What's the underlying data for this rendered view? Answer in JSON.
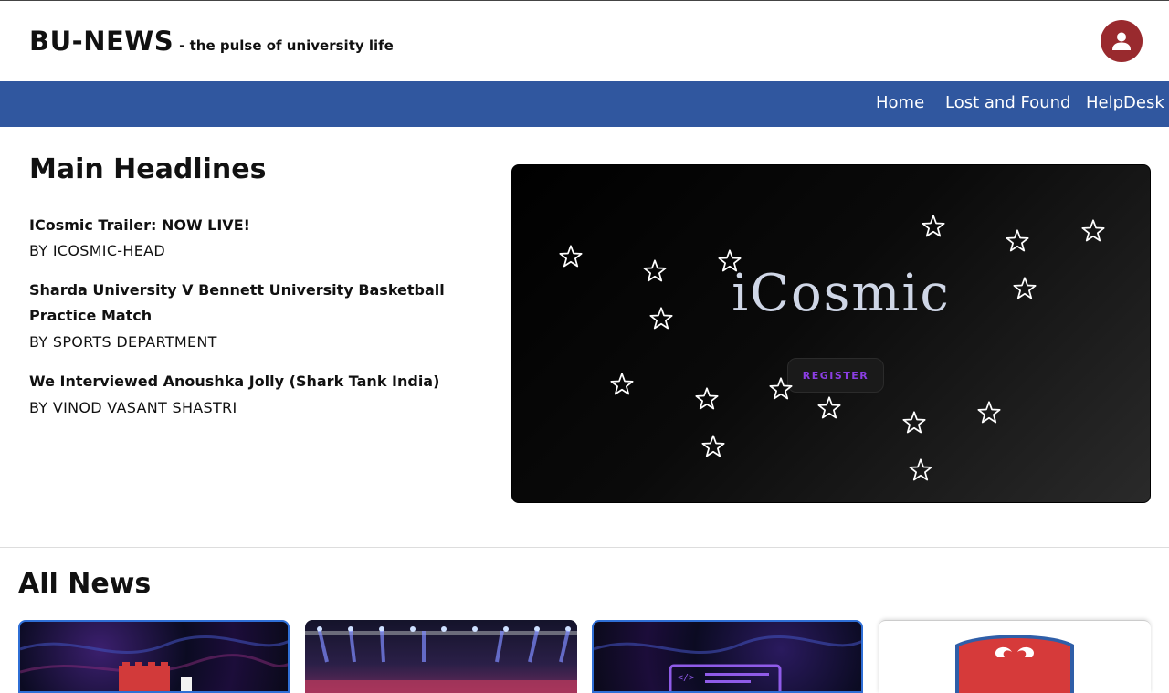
{
  "header": {
    "brand_name": "BU-NEWS",
    "tagline": "- the pulse of university life",
    "avatar_icon": "user-icon",
    "avatar_color": "#992a2e"
  },
  "nav": {
    "background": "#30579f",
    "items": [
      "Home",
      "Lost and Found",
      "HelpDesk"
    ]
  },
  "main": {
    "title": "Main Headlines",
    "headlines": [
      {
        "title": "ICosmic Trailer: NOW LIVE!",
        "author": "BY ICOSMIC-HEAD"
      },
      {
        "title": "Sharda University V Bennett University Basketball Practice Match",
        "author": "BY SPORTS DEPARTMENT"
      },
      {
        "title": "We Interviewed Anoushka Jolly (Shark Tank India)",
        "author": "BY VINOD VASANT SHASTRI"
      }
    ]
  },
  "hero": {
    "title": "iCosmic",
    "button_label": "REGISTER",
    "star_icon": "star-icon"
  },
  "all_news": {
    "title": "All News"
  }
}
